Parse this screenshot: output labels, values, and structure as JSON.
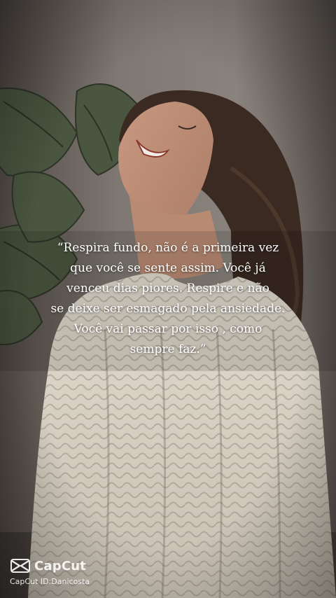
{
  "quote": {
    "lines": [
      "“Respira fundo, não é a primeira vez",
      "que você se sente assim. Você já",
      "venceu dias piores. Respire e não",
      "se deixe ser esmagado pela ansiedade.",
      "Você vai passar por isso , como",
      "sempre faz.”"
    ]
  },
  "watermark": {
    "brand": "CapCut",
    "id_text": "CapCut ID:Danicosta",
    "logo_icon": "capcut-logo-icon"
  },
  "colors": {
    "quote_text": "#ffffff",
    "background_wall": "#6f6862",
    "sweater": "#d9d2c6",
    "hair": "#3a2a22",
    "plant_leaf": "#4d5a3e"
  }
}
